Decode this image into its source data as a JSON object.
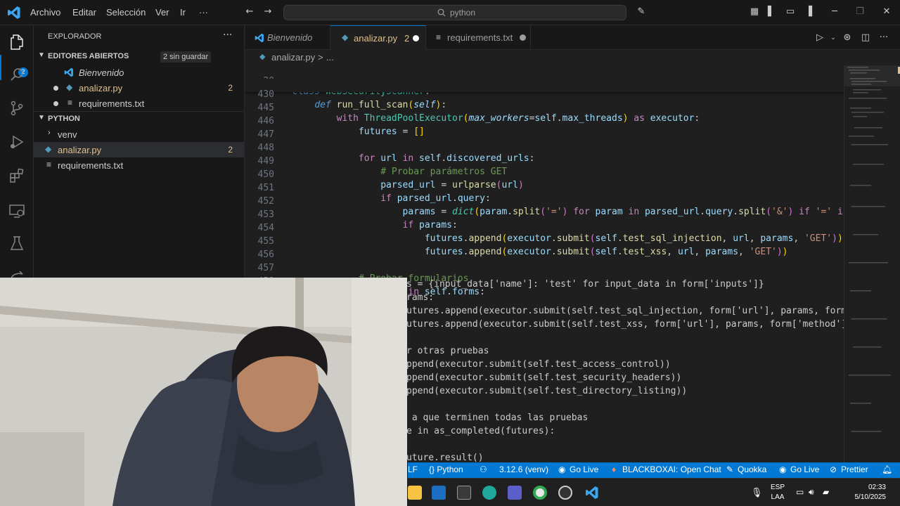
{
  "titlebar": {
    "menu": [
      "Archivo",
      "Editar",
      "Selección",
      "Ver",
      "Ir",
      "···"
    ],
    "search": "python"
  },
  "activity_badge": "2",
  "sidebar": {
    "title": "EXPLORADOR",
    "open_editors": {
      "header": "EDITORES ABIERTOS",
      "unsaved": "2 sin guardar",
      "items": [
        {
          "label": "Bienvenido",
          "count": ""
        },
        {
          "label": "analizar.py",
          "count": "2"
        },
        {
          "label": "requirements.txt",
          "count": ""
        }
      ]
    },
    "folder": {
      "header": "PYTHON",
      "items": [
        {
          "label": "venv",
          "count": ""
        },
        {
          "label": "analizar.py",
          "count": "2"
        },
        {
          "label": "requirements.txt",
          "count": ""
        }
      ]
    }
  },
  "tabs": [
    {
      "label": "Bienvenido"
    },
    {
      "label": "analizar.py",
      "count": "2"
    },
    {
      "label": "requirements.txt"
    }
  ],
  "breadcrumb": {
    "file": "analizar.py",
    "sep": ">",
    "more": "..."
  },
  "editor": {
    "line_numbers": [
      "20",
      "430",
      "445",
      "446",
      "447",
      "448",
      "449",
      "450",
      "451",
      "452",
      "453",
      "454",
      "455",
      "456",
      "457",
      "458"
    ],
    "partial_lines": [
      "s = {input_data['name']: 'test' for input_data in form['inputs']}",
      "rams:",
      "utures.append(executor.submit(self.test_sql_injection, form['url'], params, form",
      "utures.append(executor.submit(self.test_xss, form['url'], params, form['method']",
      "",
      "r otras pruebas",
      "ppend(executor.submit(self.test_access_control))",
      "ppend(executor.submit(self.test_security_headers))",
      "ppend(executor.submit(self.test_directory_listing))",
      "",
      " a que terminen todas las pruebas",
      "e in as_completed(futures):",
      "",
      "uture.result()"
    ]
  },
  "statusbar": {
    "items": [
      "LF",
      "{} Python",
      "3.12.6 (venv)",
      "Go Live",
      "BLACKBOXAI: Open Chat",
      "Quokka",
      "Go Live",
      "Prettier"
    ]
  },
  "tray": {
    "lang1": "ESP",
    "lang2": "LAA",
    "time": "02:33",
    "date": "5/10/2025"
  },
  "colors": {
    "accent": "#0078d4",
    "modified": "#e2c08d",
    "background": "#1f1f1f"
  }
}
